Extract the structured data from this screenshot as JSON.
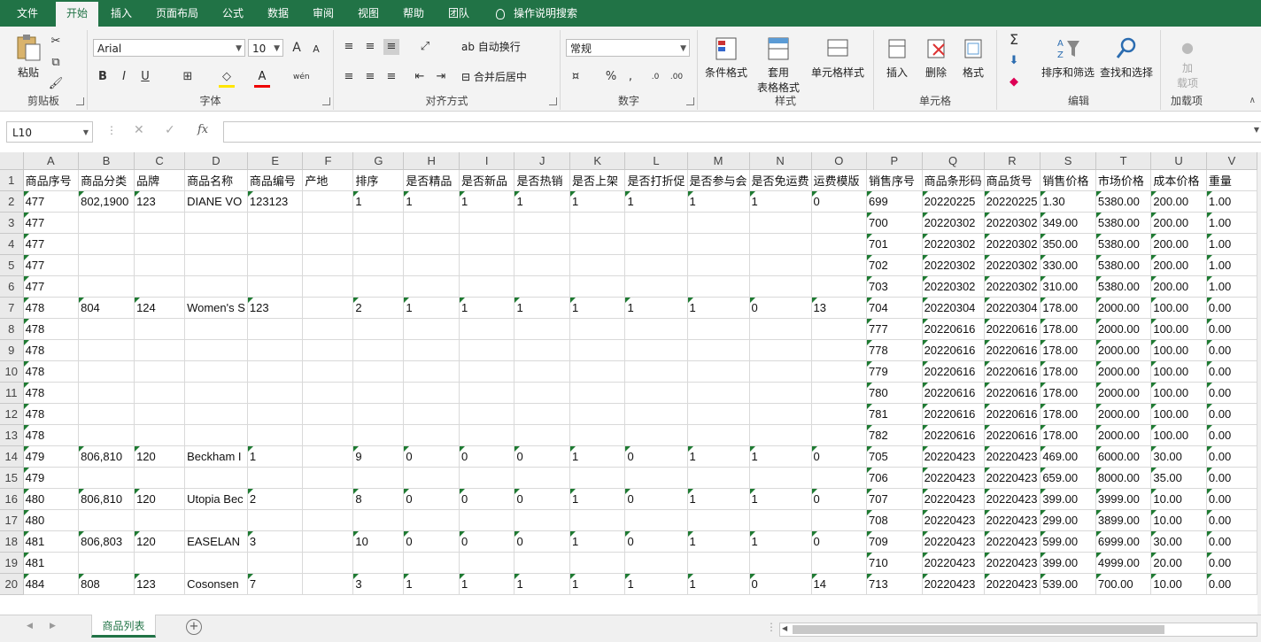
{
  "ribbon_tabs": [
    "文件",
    "开始",
    "插入",
    "页面布局",
    "公式",
    "数据",
    "审阅",
    "视图",
    "帮助",
    "团队"
  ],
  "active_tab": "开始",
  "search": {
    "label": "操作说明搜索"
  },
  "clipboard": {
    "paste": "粘贴",
    "group": "剪贴板"
  },
  "font": {
    "name": "Arial",
    "size": "10",
    "group": "字体",
    "bold": "B",
    "italic": "I",
    "underline": "U",
    "grow": "A",
    "shrink": "A",
    "phonetic": "wén"
  },
  "alignment": {
    "wrap": "自动换行",
    "merge": "合并后居中",
    "group": "对齐方式"
  },
  "number": {
    "format": "常规",
    "group": "数字",
    "percent": "%",
    "comma": ","
  },
  "styles": {
    "conditional": "条件格式",
    "table_line1": "套用",
    "table_line2": "表格格式",
    "cell_styles": "单元格样式",
    "group": "样式"
  },
  "cells": {
    "insert": "插入",
    "delete": "删除",
    "format": "格式",
    "group": "单元格"
  },
  "editing": {
    "sort_filter": "排序和筛选",
    "find_select": "查找和选择",
    "group": "编辑"
  },
  "addins": {
    "line1": "加",
    "line2": "载项",
    "group": "加载项"
  },
  "formula_bar": {
    "name_box": "L10",
    "fx": "fx",
    "value": ""
  },
  "columns": [
    "A",
    "B",
    "C",
    "D",
    "E",
    "F",
    "G",
    "H",
    "I",
    "J",
    "K",
    "L",
    "M",
    "N",
    "O",
    "P",
    "Q",
    "R",
    "S",
    "T",
    "U",
    "V"
  ],
  "rows": [
    [
      "1",
      "商品序号",
      "商品分类",
      "品牌",
      "商品名称",
      "商品编号",
      "产地",
      "排序",
      "是否精品",
      "是否新品",
      "是否热销",
      "是否上架",
      "是否打折促",
      "是否参与会",
      "是否免运费",
      "运费模版",
      "销售序号",
      "商品条形码",
      "商品货号",
      "销售价格",
      "市场价格",
      "成本价格",
      "重量"
    ],
    [
      "2",
      "477",
      "802,1900",
      "123",
      "DIANE VO",
      "123123",
      "",
      "1",
      "1",
      "1",
      "1",
      "1",
      "1",
      "1",
      "1",
      "0",
      "699",
      "20220225",
      "20220225",
      "1.30",
      "5380.00",
      "200.00",
      "1.00"
    ],
    [
      "3",
      "477",
      "",
      "",
      "",
      "",
      "",
      "",
      "",
      "",
      "",
      "",
      "",
      "",
      "",
      "",
      "700",
      "20220302",
      "20220302",
      "349.00",
      "5380.00",
      "200.00",
      "1.00"
    ],
    [
      "4",
      "477",
      "",
      "",
      "",
      "",
      "",
      "",
      "",
      "",
      "",
      "",
      "",
      "",
      "",
      "",
      "701",
      "20220302",
      "20220302",
      "350.00",
      "5380.00",
      "200.00",
      "1.00"
    ],
    [
      "5",
      "477",
      "",
      "",
      "",
      "",
      "",
      "",
      "",
      "",
      "",
      "",
      "",
      "",
      "",
      "",
      "702",
      "20220302",
      "20220302",
      "330.00",
      "5380.00",
      "200.00",
      "1.00"
    ],
    [
      "6",
      "477",
      "",
      "",
      "",
      "",
      "",
      "",
      "",
      "",
      "",
      "",
      "",
      "",
      "",
      "",
      "703",
      "20220302",
      "20220302",
      "310.00",
      "5380.00",
      "200.00",
      "1.00"
    ],
    [
      "7",
      "478",
      "804",
      "124",
      "Women's S",
      "123",
      "",
      "2",
      "1",
      "1",
      "1",
      "1",
      "1",
      "1",
      "0",
      "13",
      "704",
      "20220304",
      "20220304",
      "178.00",
      "2000.00",
      "100.00",
      "0.00"
    ],
    [
      "8",
      "478",
      "",
      "",
      "",
      "",
      "",
      "",
      "",
      "",
      "",
      "",
      "",
      "",
      "",
      "",
      "777",
      "20220616",
      "20220616",
      "178.00",
      "2000.00",
      "100.00",
      "0.00"
    ],
    [
      "9",
      "478",
      "",
      "",
      "",
      "",
      "",
      "",
      "",
      "",
      "",
      "",
      "",
      "",
      "",
      "",
      "778",
      "20220616",
      "20220616",
      "178.00",
      "2000.00",
      "100.00",
      "0.00"
    ],
    [
      "10",
      "478",
      "",
      "",
      "",
      "",
      "",
      "",
      "",
      "",
      "",
      "",
      "",
      "",
      "",
      "",
      "779",
      "20220616",
      "20220616",
      "178.00",
      "2000.00",
      "100.00",
      "0.00"
    ],
    [
      "11",
      "478",
      "",
      "",
      "",
      "",
      "",
      "",
      "",
      "",
      "",
      "",
      "",
      "",
      "",
      "",
      "780",
      "20220616",
      "20220616",
      "178.00",
      "2000.00",
      "100.00",
      "0.00"
    ],
    [
      "12",
      "478",
      "",
      "",
      "",
      "",
      "",
      "",
      "",
      "",
      "",
      "",
      "",
      "",
      "",
      "",
      "781",
      "20220616",
      "20220616",
      "178.00",
      "2000.00",
      "100.00",
      "0.00"
    ],
    [
      "13",
      "478",
      "",
      "",
      "",
      "",
      "",
      "",
      "",
      "",
      "",
      "",
      "",
      "",
      "",
      "",
      "782",
      "20220616",
      "20220616",
      "178.00",
      "2000.00",
      "100.00",
      "0.00"
    ],
    [
      "14",
      "479",
      "806,810",
      "120",
      "Beckham I",
      "1",
      "",
      "9",
      "0",
      "0",
      "0",
      "1",
      "0",
      "1",
      "1",
      "0",
      "705",
      "20220423",
      "20220423",
      "469.00",
      "6000.00",
      "30.00",
      "0.00"
    ],
    [
      "15",
      "479",
      "",
      "",
      "",
      "",
      "",
      "",
      "",
      "",
      "",
      "",
      "",
      "",
      "",
      "",
      "706",
      "20220423",
      "20220423",
      "659.00",
      "8000.00",
      "35.00",
      "0.00"
    ],
    [
      "16",
      "480",
      "806,810",
      "120",
      "Utopia Bec",
      "2",
      "",
      "8",
      "0",
      "0",
      "0",
      "1",
      "0",
      "1",
      "1",
      "0",
      "707",
      "20220423",
      "20220423",
      "399.00",
      "3999.00",
      "10.00",
      "0.00"
    ],
    [
      "17",
      "480",
      "",
      "",
      "",
      "",
      "",
      "",
      "",
      "",
      "",
      "",
      "",
      "",
      "",
      "",
      "708",
      "20220423",
      "20220423",
      "299.00",
      "3899.00",
      "10.00",
      "0.00"
    ],
    [
      "18",
      "481",
      "806,803",
      "120",
      "EASELAN",
      "3",
      "",
      "10",
      "0",
      "0",
      "0",
      "1",
      "0",
      "1",
      "1",
      "0",
      "709",
      "20220423",
      "20220423",
      "599.00",
      "6999.00",
      "30.00",
      "0.00"
    ],
    [
      "19",
      "481",
      "",
      "",
      "",
      "",
      "",
      "",
      "",
      "",
      "",
      "",
      "",
      "",
      "",
      "",
      "710",
      "20220423",
      "20220423",
      "399.00",
      "4999.00",
      "20.00",
      "0.00"
    ],
    [
      "20",
      "484",
      "808",
      "123",
      "Cosonsen",
      "7",
      "",
      "3",
      "1",
      "1",
      "1",
      "1",
      "1",
      "1",
      "0",
      "14",
      "713",
      "20220423",
      "20220423",
      "539.00",
      "700.00",
      "10.00",
      "0.00"
    ]
  ],
  "sheet_tab": "商品列表"
}
